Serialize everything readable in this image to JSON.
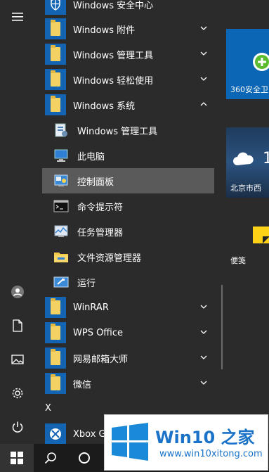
{
  "apps": {
    "security": "Windows 安全中心",
    "accessories": "Windows 附件",
    "admin_tools": "Windows 管理工具",
    "ease_access": "Windows 轻松使用",
    "system": "Windows 系统",
    "sys_admin": "Windows 管理工具",
    "this_pc": "此电脑",
    "control_panel": "控制面板",
    "cmd": "命令提示符",
    "task_mgr": "任务管理器",
    "explorer": "文件资源管理器",
    "run": "运行",
    "winrar": "WinRAR",
    "wps": "WPS Office",
    "mail_master": "网易邮箱大师",
    "wechat": "微信",
    "section_x": "X",
    "xbox": "Xbox Ga"
  },
  "tiles": {
    "security360": "360安全卫",
    "weather_city": "北京市西",
    "weather_temp": "1",
    "sticky_notes": "便笺"
  },
  "watermark": {
    "title": "Win10 之家",
    "url": "www.win10xitong.com"
  },
  "colors": {
    "accent": "#1464b4",
    "folder": "#f3d163",
    "selected": "#5a5a5a"
  }
}
